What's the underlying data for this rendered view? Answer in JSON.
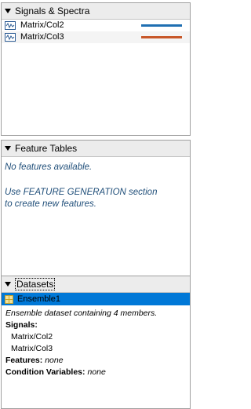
{
  "signals_panel": {
    "title": "Signals & Spectra",
    "items": [
      {
        "label": "Matrix/Col2",
        "color": "#1f6fb2"
      },
      {
        "label": "Matrix/Col3",
        "color": "#c8582a"
      }
    ]
  },
  "features_panel": {
    "title": "Feature Tables",
    "empty_message": "No features available.",
    "hint_line1": "Use FEATURE GENERATION section",
    "hint_line2": "to create new features."
  },
  "datasets_panel": {
    "title": "Datasets",
    "selected_dataset": "Ensemble1",
    "description": "Ensemble dataset containing 4 members.",
    "signals_label": "Signals:",
    "signals": [
      "Matrix/Col2",
      "Matrix/Col3"
    ],
    "features_label": "Features:",
    "features_value": "none",
    "condvars_label": "Condition Variables:",
    "condvars_value": "none"
  },
  "colors": {
    "selection": "#0078d7",
    "hint_text": "#1f4e79"
  }
}
